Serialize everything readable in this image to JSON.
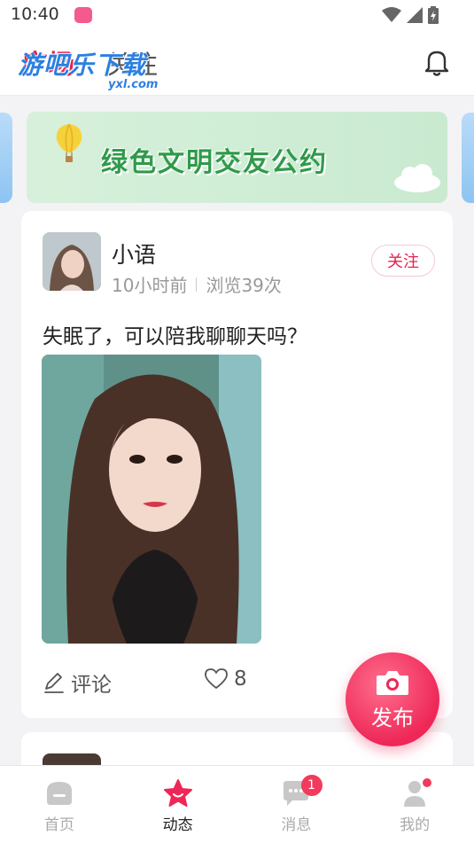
{
  "status_bar": {
    "time": "10:40"
  },
  "header": {
    "tab_square": "广场",
    "tab_follow": "关注",
    "watermark": "游吧乐下载",
    "watermark_sub": "yxl.com"
  },
  "banner": {
    "text": "绿色文明交友公约"
  },
  "post": {
    "username": "小语",
    "time_ago": "10小时前",
    "views": "浏览39次",
    "follow_label": "关注",
    "content": "失眠了，可以陪我聊聊天吗？",
    "comment_label": "评论",
    "like_count": "8"
  },
  "fab": {
    "label": "发布"
  },
  "nav": {
    "items": [
      {
        "label": "首页"
      },
      {
        "label": "动态"
      },
      {
        "label": "消息",
        "badge": "1"
      },
      {
        "label": "我的"
      }
    ]
  },
  "colors": {
    "accent": "#e8224f",
    "fab": "#ee2757",
    "banner_text": "#2f9a4a"
  }
}
